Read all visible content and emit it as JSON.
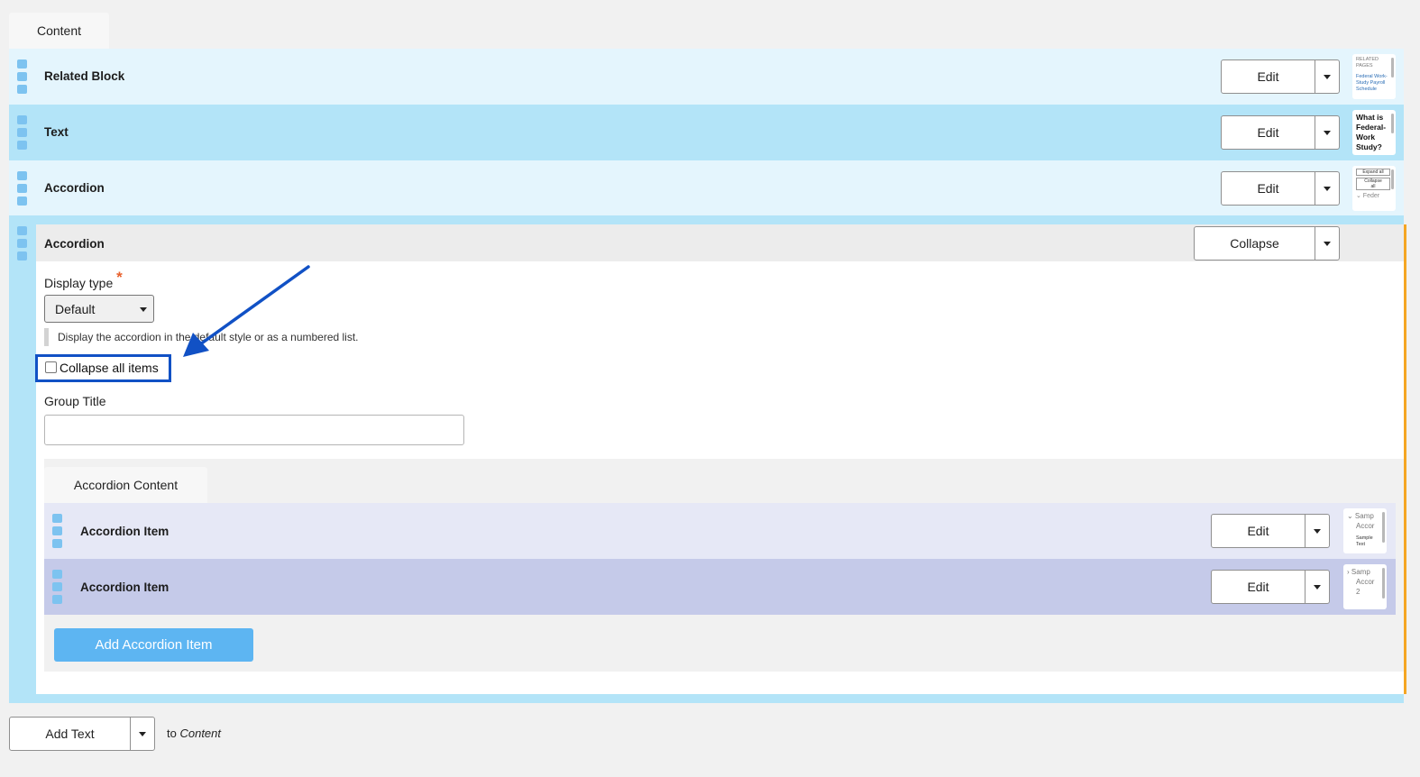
{
  "content_tab": "Content",
  "rows": [
    {
      "title": "Related Block",
      "action": "Edit",
      "thumb": [
        "RELATED",
        "PAGES",
        "",
        "Federal Work-",
        "Study Payroll",
        "Schedule"
      ]
    },
    {
      "title": "Text",
      "action": "Edit",
      "thumb": [
        "What is",
        "Federal-",
        "Work",
        "Study?"
      ]
    },
    {
      "title": "Accordion",
      "action": "Edit",
      "thumb": [
        "Expand all",
        "Collapse",
        "all",
        "⌄ Feder"
      ]
    }
  ],
  "expanded": {
    "title": "Accordion",
    "action": "Collapse",
    "display_type_label": "Display type",
    "required_mark": "*",
    "display_type_value": "Default",
    "help_text": "Display the accordion in the default style or as a numbered list.",
    "collapse_all_label": "Collapse all items",
    "collapse_all_checked": false,
    "group_title_label": "Group Title",
    "group_title_value": "",
    "accordion_content_tab": "Accordion Content",
    "items": [
      {
        "title": "Accordion Item",
        "action": "Edit",
        "thumb": [
          "⌄ Samp",
          "Accor",
          "",
          "Sample",
          "Text"
        ]
      },
      {
        "title": "Accordion Item",
        "action": "Edit",
        "thumb": [
          "› Samp",
          "Accor",
          "2"
        ]
      }
    ],
    "add_item_label": "Add Accordion Item"
  },
  "footer": {
    "add_label": "Add Text",
    "to_prefix": "to",
    "to_target": "Content"
  },
  "colors": {
    "accent": "#5db5f2",
    "highlight": "#1151c5",
    "orange_bar": "#f5a623",
    "required": "#e8602c"
  }
}
